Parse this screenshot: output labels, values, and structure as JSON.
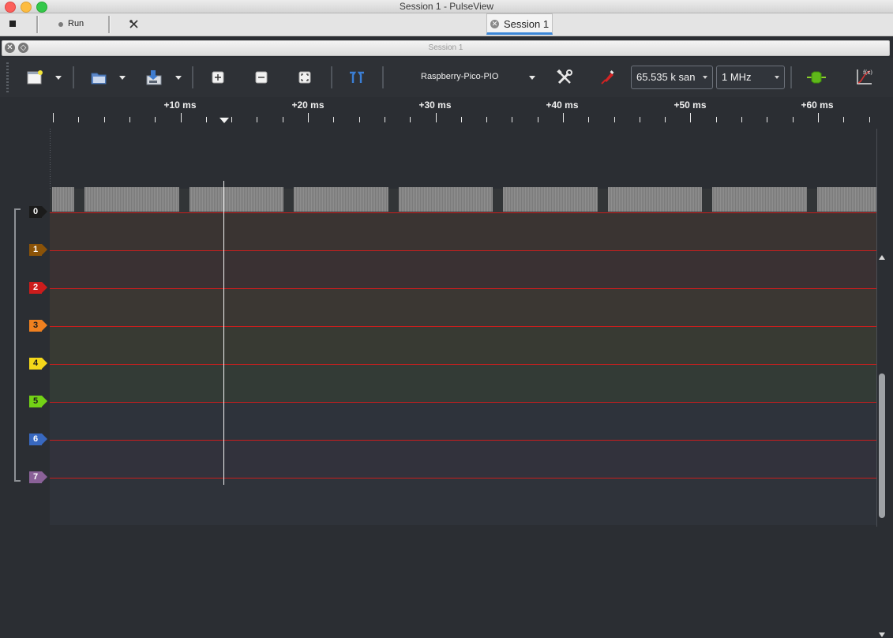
{
  "window": {
    "title": "Session 1 - PulseView"
  },
  "main_toolbar": {
    "run_label": "Run",
    "session_tab_label": "Session 1"
  },
  "dock": {
    "title": "Session 1"
  },
  "session_toolbar": {
    "device": "Raspberry-Pico-PIO",
    "sample_count": "65.535 k san",
    "sample_rate": "1 MHz"
  },
  "ruler": {
    "labels": [
      "+10 ms",
      "+20 ms",
      "+30 ms",
      "+40 ms",
      "+50 ms",
      "+60 ms"
    ]
  },
  "channels": [
    {
      "name": "0",
      "color": "#1b1b1b",
      "text": "#ffffff",
      "band": "#323537"
    },
    {
      "name": "1",
      "color": "#8b5308",
      "text": "#ffffff",
      "band": "#3a3432"
    },
    {
      "name": "2",
      "color": "#cc1c1c",
      "text": "#ffffff",
      "band": "#3a3133"
    },
    {
      "name": "3",
      "color": "#f0801f",
      "text": "#1c1c1c",
      "band": "#3b3733"
    },
    {
      "name": "4",
      "color": "#f4d71a",
      "text": "#1c1c1c",
      "band": "#383a33"
    },
    {
      "name": "5",
      "color": "#73d216",
      "text": "#1c1c1c",
      "band": "#333b36"
    },
    {
      "name": "6",
      "color": "#3868bf",
      "text": "#ffffff",
      "band": "#2e333b"
    },
    {
      "name": "7",
      "color": "#8a6198",
      "text": "#ffffff",
      "band": "#32323c"
    }
  ],
  "colors": {
    "trace_line": "#c81e1e",
    "cursor": "#f2f2f2",
    "accent": "#3b87d8"
  }
}
